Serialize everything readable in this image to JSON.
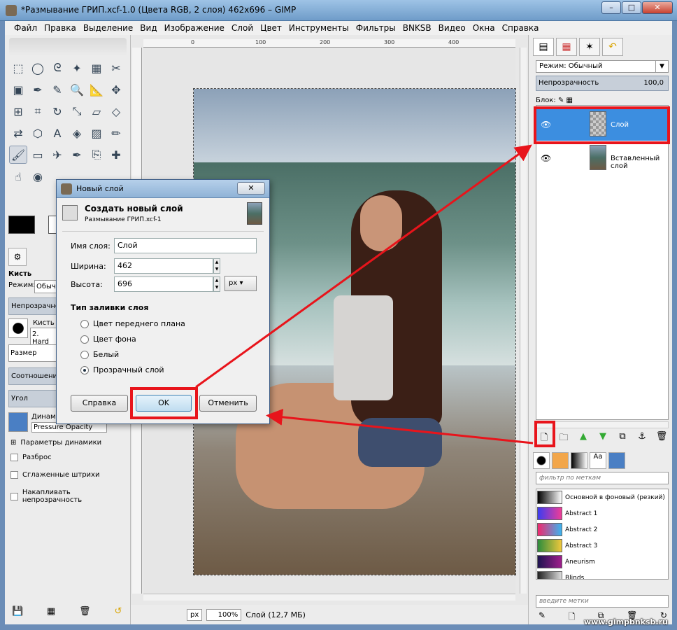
{
  "window": {
    "title": "*Размывание ГРИП.xcf-1.0 (Цвета RGB, 2 слоя) 462x696 – GIMP",
    "buttons": {
      "minimize": "–",
      "maximize": "□",
      "close": "✕"
    }
  },
  "menu": [
    "Файл",
    "Правка",
    "Выделение",
    "Вид",
    "Изображение",
    "Слой",
    "Цвет",
    "Инструменты",
    "Фильтры",
    "BNKSB",
    "Видео",
    "Окна",
    "Справка"
  ],
  "toolbox": {
    "tools": [
      "rect-select-icon",
      "ellipse-select-icon",
      "lasso-icon",
      "fuzzy-select-icon",
      "by-color-select-icon",
      "scissors-icon",
      "foreground-select-icon",
      "paths-icon",
      "color-picker-icon",
      "zoom-icon",
      "measure-icon",
      "move-icon",
      "align-icon",
      "crop-icon",
      "rotate-icon",
      "scale-icon",
      "shear-icon",
      "perspective-icon",
      "flip-icon",
      "cage-icon",
      "text-icon",
      "bucket-fill-icon",
      "blend-icon",
      "pencil-icon",
      "paintbrush-icon",
      "eraser-icon",
      "airbrush-icon",
      "ink-icon",
      "clone-icon",
      "heal-icon",
      "smudge-icon",
      "blur-icon"
    ],
    "tool_glyphs": [
      "⬚",
      "◯",
      "ᘓ",
      "✦",
      "▦",
      "✂",
      "▣",
      "✒",
      "✎",
      "🔍",
      "📐",
      "✥",
      "⊞",
      "⌗",
      "↻",
      "⤡",
      "▱",
      "◇",
      "⇄",
      "⬡",
      "A",
      "◈",
      "▨",
      "✏",
      "🖌",
      "▭",
      "✈",
      "✒",
      "⎘",
      "✚",
      "☝",
      "◉"
    ],
    "options_title": "Кисть",
    "mode_label": "Режим:",
    "mode_value": "Обычн",
    "opacity_label": "Непрозрачность",
    "brush_label": "Кисть",
    "brush_value": "2. Hard",
    "size_label": "Размер",
    "ratio_label": "Соотношение",
    "angle_label": "Угол",
    "dynamics_label": "Динами",
    "dynamics_value": "Pressure Opacity",
    "dynamics_params": "Параметры динамики",
    "checks": [
      "Разброс",
      "Сглаженные штрихи",
      "Накапливать непрозрачность"
    ]
  },
  "canvas": {
    "ruler_ticks": [
      "0",
      "100",
      "200",
      "300",
      "400"
    ],
    "unit": "px",
    "zoom": "100%",
    "status": "Слой (12,7 МБ)"
  },
  "layers_dock": {
    "mode_label": "Режим: Обычный",
    "opacity_label": "Непрозрачность",
    "opacity_value": "100,0",
    "lock_label": "Блок:",
    "layers": [
      {
        "name": "Слой",
        "selected": true
      },
      {
        "name": "Вставленный слой",
        "selected": false
      }
    ],
    "gradient_filter_placeholder": "фильтр по меткам",
    "gradients": [
      {
        "name": "Основной в фоновый (резкий)",
        "colors": [
          "#000000",
          "#ffffff"
        ]
      },
      {
        "name": "Abstract 1",
        "colors": [
          "#3c3cf0",
          "#f03c96"
        ]
      },
      {
        "name": "Abstract 2",
        "colors": [
          "#f0286e",
          "#3cb4f0"
        ]
      },
      {
        "name": "Abstract 3",
        "colors": [
          "#2d8c3c",
          "#f0c83c"
        ]
      },
      {
        "name": "Aneurism",
        "colors": [
          "#1e1450",
          "#a01e8c"
        ]
      },
      {
        "name": "Blinds",
        "colors": [
          "#222222",
          "#dddddd"
        ]
      }
    ],
    "tags_placeholder": "введите метки"
  },
  "dialog": {
    "window_title": "Новый слой",
    "close": "✕",
    "heading": "Создать новый слой",
    "subheading": "Размывание ГРИП.xcf-1",
    "name_label": "Имя слоя:",
    "name_value": "Слой",
    "width_label": "Ширина:",
    "width_value": "462",
    "height_label": "Высота:",
    "height_value": "696",
    "unit": "px",
    "fill_title": "Тип заливки слоя",
    "fill_options": [
      {
        "label": "Цвет переднего плана",
        "selected": false
      },
      {
        "label": "Цвет фона",
        "selected": false
      },
      {
        "label": "Белый",
        "selected": false
      },
      {
        "label": "Прозрачный слой",
        "selected": true
      }
    ],
    "help_button": "Справка",
    "ok_button": "OK",
    "cancel_button": "Отменить"
  },
  "watermark": "www.gimpbnksb.ru",
  "colors": {
    "highlight": "#e8141b",
    "selection": "#3c8ee0"
  }
}
